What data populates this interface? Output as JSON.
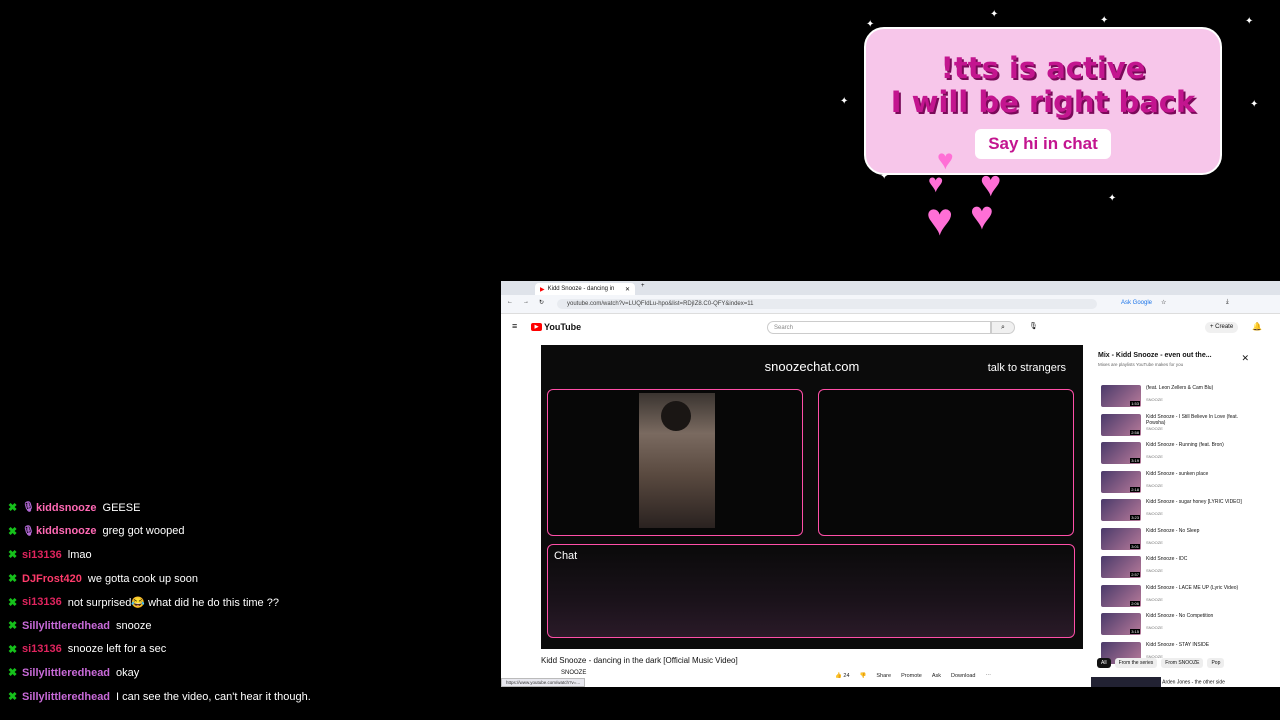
{
  "overlay": {
    "brb_line1": "!tts is active",
    "brb_line2": "I will be right back",
    "say_hi": "Say hi in chat",
    "colors": {
      "panel": "#f7c6ea",
      "text": "#c3158f",
      "hearts": "#ff6fd6"
    }
  },
  "chat": [
    {
      "user": "kiddsnooze",
      "message": "GEESE",
      "color": "#ff69b4",
      "mic": true
    },
    {
      "user": "kiddsnooze",
      "message": "greg got wooped",
      "color": "#ff69b4",
      "mic": true
    },
    {
      "user": "si13136",
      "message": "lmao",
      "color": "#e0245e",
      "mic": false
    },
    {
      "user": "DJFrost420",
      "message": "we gotta cook up soon",
      "color": "#ff3b6b",
      "mic": false
    },
    {
      "user": "si13136",
      "message": "not surprised😂 what did he do this time ??",
      "color": "#e0245e",
      "mic": false
    },
    {
      "user": "Sillylittleredhead",
      "message": "snooze",
      "color": "#c86ad8",
      "mic": false
    },
    {
      "user": "si13136",
      "message": "snooze left for a sec",
      "color": "#e0245e",
      "mic": false
    },
    {
      "user": "Sillylittleredhead",
      "message": "okay",
      "color": "#c86ad8",
      "mic": false
    },
    {
      "user": "Sillylittleredhead",
      "message": "I can see the video, can't hear it though.",
      "color": "#c86ad8",
      "mic": false
    }
  ],
  "browser": {
    "tab_title": "Kidd Snooze - dancing in",
    "url": "youtube.com/watch?v=LUQFIdLu-hpo&list=RDjIZ8.C0-QFY&index=11",
    "ask_google": "Ask Google",
    "youtube_label": "YouTube",
    "search_placeholder": "Search",
    "create_label": "+ Create",
    "player": {
      "site": "snoozechat.com",
      "talk": "talk to strangers",
      "chat_label": "Chat"
    },
    "video_title": "Kidd Snooze - dancing in the dark [Official Music Video]",
    "channel": "SNOOZE",
    "actions": [
      "24",
      "Share",
      "Promote",
      "Ask",
      "Download"
    ],
    "status_url": "https://www.youtube.com/watch?v=...",
    "playlist": {
      "title": "Mix - Kidd Snooze - even out the...",
      "subtitle": "Mixes are playlists YouTube makes for you",
      "items": [
        {
          "name": "(feat. Leon Zellers & Cam Blu)",
          "channel": "SNOOZE",
          "duration": "1:53"
        },
        {
          "name": "Kidd Snooze - I Still Believe In Love (feat. Powsha)",
          "channel": "SNOOZE",
          "duration": "2:58"
        },
        {
          "name": "Kidd Snooze - Running (feat. Bron)",
          "channel": "SNOOZE",
          "duration": "3:19"
        },
        {
          "name": "Kidd Snooze - sunken place",
          "channel": "SNOOZE",
          "duration": "2:18"
        },
        {
          "name": "Kidd Snooze - sugar honey [LYRIC VIDEO]",
          "channel": "SNOOZE",
          "duration": "3:23"
        },
        {
          "name": "Kidd Snooze - No Sleep",
          "channel": "SNOOZE",
          "duration": "3:01"
        },
        {
          "name": "Kidd Snooze - IDC",
          "channel": "SNOOZE",
          "duration": "2:57"
        },
        {
          "name": "Kidd Snooze - LACE ME UP (Lyric Video)",
          "channel": "SNOOZE",
          "duration": "2:06"
        },
        {
          "name": "Kidd Snooze - No Competition",
          "channel": "SNOOZE",
          "duration": "3:15"
        },
        {
          "name": "Kidd Snooze - STAY INSIDE",
          "channel": "SNOOZE",
          "duration": ""
        }
      ],
      "chips": [
        "All",
        "From the series",
        "From SNOOZE",
        "Pop"
      ],
      "recommended": "Arden Jones - the other side"
    }
  }
}
